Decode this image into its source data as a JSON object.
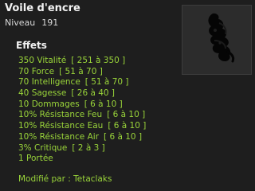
{
  "item": {
    "name": "Voile d'encre",
    "level_label": "Niveau",
    "level_value": "191",
    "image_icon": "ink-veil-cape-icon"
  },
  "effects": {
    "title": "Effets",
    "lines": [
      {
        "value": "350 Vitalité",
        "range": "[ 251 à 350 ]"
      },
      {
        "value": "70 Force",
        "range": "[ 51 à 70 ]"
      },
      {
        "value": "70 Intelligence",
        "range": "[ 51 à 70 ]"
      },
      {
        "value": "40 Sagesse",
        "range": "[ 26 à 40 ]"
      },
      {
        "value": "10 Dommages",
        "range": "[ 6 à 10 ]"
      },
      {
        "value": "10% Résistance Feu",
        "range": "[ 6 à 10 ]"
      },
      {
        "value": "10% Résistance Eau",
        "range": "[ 6 à 10 ]"
      },
      {
        "value": "10% Résistance Air",
        "range": "[ 6 à 10 ]"
      },
      {
        "value": "3% Critique",
        "range": "[ 2 à 3 ]"
      },
      {
        "value": "1 Portée",
        "range": ""
      }
    ],
    "modified_by": "Modifié par : Tetaclaks"
  },
  "colors": {
    "background": "#1e1e1e",
    "effect_text": "#9ad53a",
    "title_text": "#f2f2f2"
  }
}
